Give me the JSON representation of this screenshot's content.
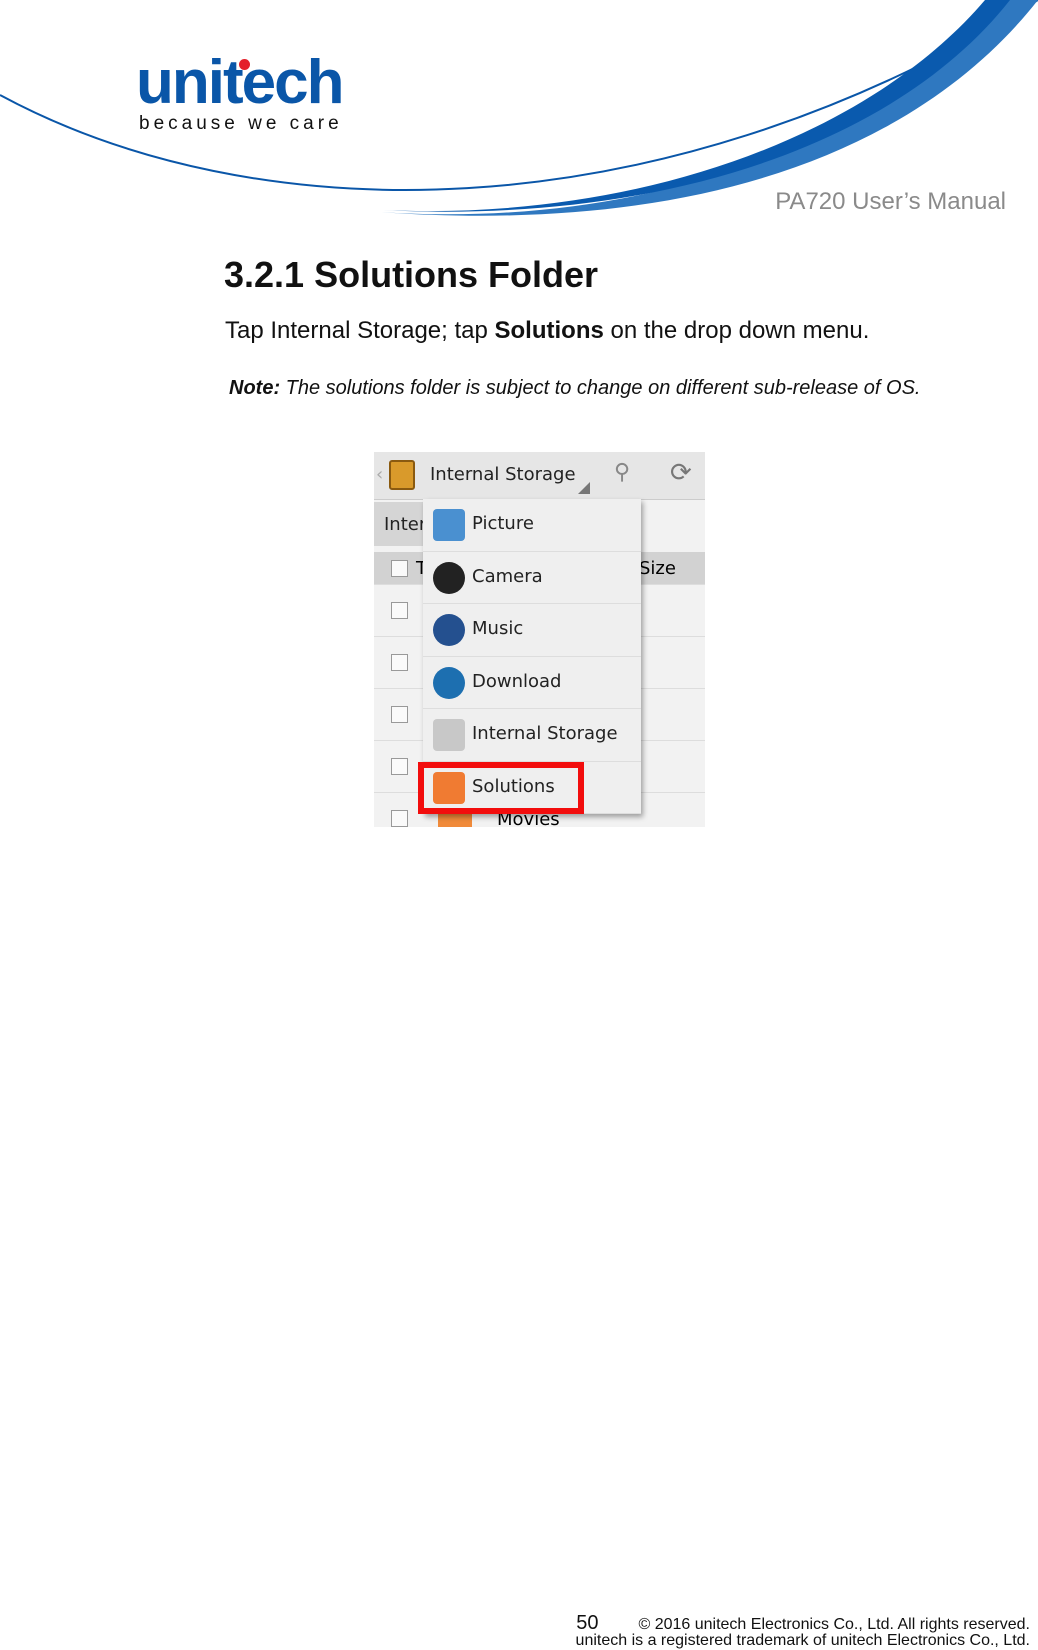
{
  "header": {
    "logo": "unitech",
    "tagline": "because we care",
    "manual_title": "PA720 User’s Manual"
  },
  "section": {
    "title": "3.2.1 Solutions Folder",
    "instruction_pre": "Tap Internal Storage; tap ",
    "instruction_bold": "Solutions",
    "instruction_post": " on the drop down menu.",
    "note_label": "Note:",
    "note_text": " The solutions folder is subject to change on different sub-release of OS."
  },
  "screenshot": {
    "toolbar_title": "Internal Storage",
    "path_partial": "Inter",
    "column_partial_t": "T",
    "column_size": "Size",
    "partial_item": "Movies",
    "menu": [
      {
        "label": "Picture",
        "icon": "picture-icon",
        "color": "#4a90d0"
      },
      {
        "label": "Camera",
        "icon": "camera-icon",
        "color": "#222222"
      },
      {
        "label": "Music",
        "icon": "music-icon",
        "color": "#24508f"
      },
      {
        "label": "Download",
        "icon": "globe-download-icon",
        "color": "#1d6fb0"
      },
      {
        "label": "Internal Storage",
        "icon": "drive-icon",
        "color": "#c8c8c8"
      },
      {
        "label": "Solutions",
        "icon": "folder-icon",
        "color": "#f07b32"
      }
    ],
    "highlight_color": "#f20d0d"
  },
  "footer": {
    "page": "50",
    "copyright": "© 2016 unitech Electronics Co., Ltd. All rights reserved.",
    "trademark": "unitech is a registered trademark of unitech Electronics Co., Ltd."
  }
}
